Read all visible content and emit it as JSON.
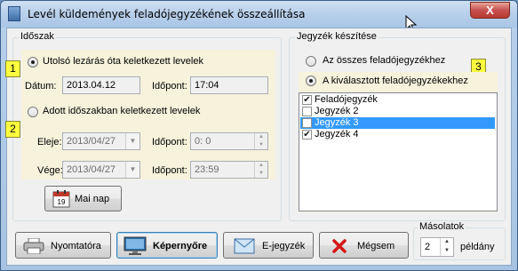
{
  "window": {
    "title": "Levél küldemények feladójegyzékének összeállítása",
    "close_glyph": "X"
  },
  "period": {
    "group_title": "Időszak",
    "badge1": "1",
    "badge2": "2",
    "option_since_last_close": "Utolsó lezárás óta keletkezett levelek",
    "date_label": "Dátum:",
    "date_value": "2013.04.12",
    "time_label": "Időpont:",
    "time_value": "17:04",
    "option_period": "Adott időszakban keletkezett levelek",
    "start_label": "Eleje:",
    "start_date": "2013/04/27",
    "start_time_label": "Időpont:",
    "start_time": "0:  0",
    "end_label": "Vége:",
    "end_date": "2013/04/27",
    "end_time_label": "Időpont:",
    "end_time": "23:59",
    "today_button": "Mai nap",
    "calendar_number": "19"
  },
  "list": {
    "group_title": "Jegyzék készítése",
    "badge3": "3",
    "option_all": "Az összes feladójegyzékhez",
    "option_selected": "A kiválasztott feladójegyzékekhez",
    "items": [
      {
        "label": "Feladójegyzék",
        "checked": true,
        "selected": false
      },
      {
        "label": "Jegyzék 2",
        "checked": false,
        "selected": false
      },
      {
        "label": "Jegyzék 3",
        "checked": false,
        "selected": true
      },
      {
        "label": "Jegyzék 4",
        "checked": true,
        "selected": false
      }
    ]
  },
  "footer": {
    "printer_button": "Nyomtatóra",
    "screen_button": "Képernyőre",
    "email_button": "E-jegyzék",
    "cancel_button": "Mégsem",
    "copies_group": "Másolatok",
    "copies_value": "2",
    "copies_suffix": "példány"
  },
  "colors": {
    "badge": "#ffff40",
    "panel": "#f6f2dc",
    "selection": "#3399ff"
  }
}
